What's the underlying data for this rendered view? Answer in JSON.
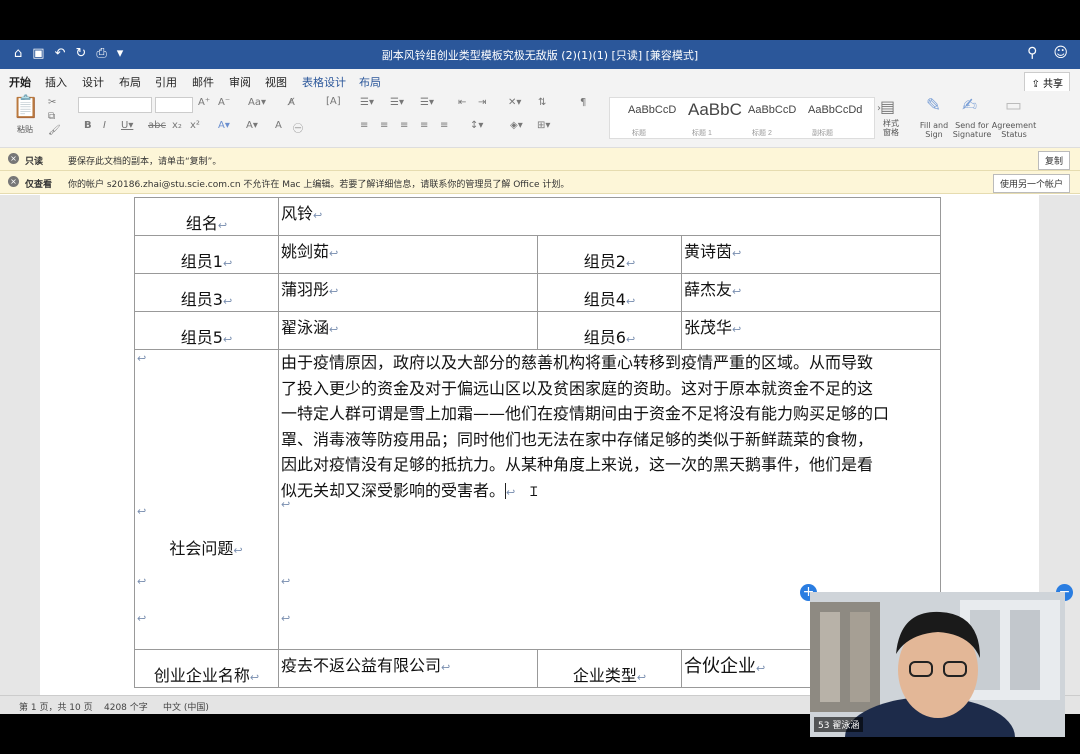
{
  "window": {
    "title": "副本风铃组创业类型模板究极无敌版 (2)(1)(1) [只读] [兼容模式]"
  },
  "tabs": [
    "开始",
    "插入",
    "设计",
    "布局",
    "引用",
    "邮件",
    "审阅",
    "视图",
    "表格设计",
    "布局"
  ],
  "share_label": "共享",
  "ribbon": {
    "paste_label": "粘贴",
    "style_samples": [
      {
        "preview": "AaBbCcD",
        "name": "标题"
      },
      {
        "preview": "AaBbC",
        "name": "标题 1"
      },
      {
        "preview": "AaBbCcD",
        "name": "标题 2"
      },
      {
        "preview": "AaBbCcDd",
        "name": "副标题"
      }
    ],
    "styles_pane_label": "样式\n窗格",
    "fill_sign": "Fill and\nSign",
    "send_signature": "Send for\nSignature",
    "agreement_status": "Agreement\nStatus"
  },
  "notices": [
    {
      "label": "只读",
      "message": "要保存此文档的副本，请单击“复制”。",
      "button": "复制"
    },
    {
      "label": "仅查看",
      "message": "你的帐户 s20186.zhai@stu.scie.com.cn 不允许在 Mac 上编辑。若要了解详细信息，请联系你的管理员了解 Office 计划。",
      "button": "使用另一个帐户"
    }
  ],
  "document": {
    "group_label": "组名",
    "group_value": "风铃",
    "members": [
      {
        "label": "组员1",
        "value": "姚剑茹"
      },
      {
        "label": "组员2",
        "value": "黄诗茵"
      },
      {
        "label": "组员3",
        "value": "蒲羽彤"
      },
      {
        "label": "组员4",
        "value": "薛杰友"
      },
      {
        "label": "组员5",
        "value": "翟泳涵"
      },
      {
        "label": "组员6",
        "value": "张茂华"
      }
    ],
    "social_label": "社会问题",
    "social_lines": [
      "由于疫情原因，政府以及大部分的慈善机构将重心转移到疫情严重的区域。从而导致",
      "了投入更少的资金及对于偏远山区以及贫困家庭的资助。这对于原本就资金不足的这",
      "一特定人群可谓是雪上加霜——他们在疫情期间由于资金不足将没有能力购买足够的口",
      "罩、消毒液等防疫用品；同时他们也无法在家中存储足够的类似于新鲜蔬菜的食物，",
      "因此对疫情没有足够的抵抗力。从某种角度上来说，这一次的黑天鹅事件，他们是看",
      "似无关却又深受影响的受害者。"
    ],
    "company_label": "创业企业名称",
    "company_value": "疫去不返公益有限公司",
    "type_label": "企业类型",
    "type_value": "合伙企业"
  },
  "status": {
    "page": "第 1 页，共 10 页",
    "words": "4208 个字",
    "language": "中文 (中国)"
  },
  "video": {
    "participant": "53 翟泳涵"
  },
  "colors": {
    "titlebar": "#2b579a",
    "notice_bg": "#fdf6d8",
    "accent_blue": "#2a7de1"
  }
}
